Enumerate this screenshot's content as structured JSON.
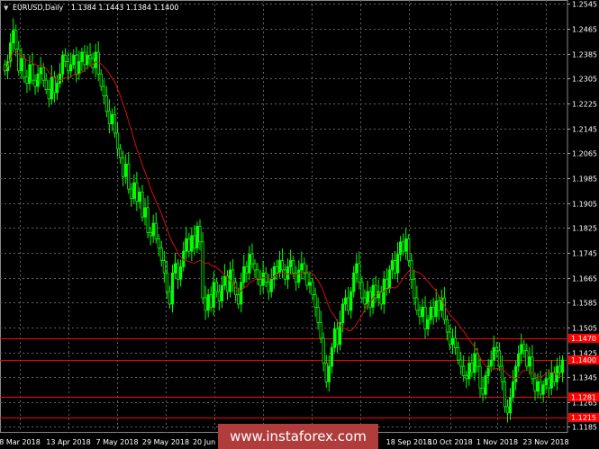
{
  "header": {
    "symbol": "EURUSD,Daily",
    "ohlc": "1.1384 1.1443 1.1384 1.1400"
  },
  "watermark": "www.instaforex.com",
  "colors": {
    "background": "#000000",
    "bull": "#00ff00",
    "bear": "#00ff00",
    "ma": "#d01010",
    "level": "#ff0000",
    "grid": "#606060",
    "price_box": "#ff0000"
  },
  "chart_data": {
    "type": "candlestick",
    "title": "EURUSD,Daily",
    "x_ticks": [
      "8 Mar 2018",
      "13 Apr 2018",
      "7 May 2018",
      "29 May 2018",
      "20 Jun 2018",
      "18 Sep 2018",
      "10 Oct 2018",
      "1 Nov 2018",
      "23 Nov 2018"
    ],
    "y_ticks": [
      "1.2545",
      "1.2465",
      "1.2385",
      "1.2305",
      "1.2225",
      "1.2145",
      "1.2065",
      "1.1985",
      "1.1905",
      "1.1825",
      "1.1745",
      "1.1665",
      "1.1585",
      "1.1505",
      "1.1425",
      "1.1345",
      "1.1265",
      "1.1185"
    ],
    "ylim": [
      1.1166,
      1.2558
    ],
    "grid": true,
    "levels": [
      {
        "value": 1.147,
        "label": "1.1470"
      },
      {
        "value": 1.14,
        "label": "1.1400"
      },
      {
        "value": 1.1281,
        "label": "1.1281"
      },
      {
        "value": 1.1215,
        "label": "1.1215"
      }
    ],
    "closes": [
      1.233,
      1.236,
      1.242,
      1.246,
      1.24,
      1.233,
      1.237,
      1.231,
      1.229,
      1.235,
      1.23,
      1.228,
      1.232,
      1.234,
      1.23,
      1.227,
      1.224,
      1.231,
      1.226,
      1.229,
      1.232,
      1.238,
      1.236,
      1.233,
      1.235,
      1.238,
      1.232,
      1.236,
      1.239,
      1.235,
      1.238,
      1.237,
      1.234,
      1.239,
      1.232,
      1.228,
      1.225,
      1.22,
      1.216,
      1.219,
      1.213,
      1.208,
      1.205,
      1.199,
      1.203,
      1.195,
      1.192,
      1.197,
      1.191,
      1.194,
      1.186,
      1.189,
      1.181,
      1.18,
      1.184,
      1.179,
      1.176,
      1.172,
      1.168,
      1.162,
      1.158,
      1.168,
      1.171,
      1.166,
      1.17,
      1.175,
      1.179,
      1.175,
      1.18,
      1.176,
      1.183,
      1.178,
      1.16,
      1.156,
      1.161,
      1.157,
      1.165,
      1.162,
      1.159,
      1.164,
      1.167,
      1.162,
      1.169,
      1.165,
      1.161,
      1.158,
      1.165,
      1.17,
      1.168,
      1.174,
      1.171,
      1.169,
      1.166,
      1.164,
      1.168,
      1.165,
      1.162,
      1.166,
      1.17,
      1.168,
      1.172,
      1.169,
      1.166,
      1.17,
      1.172,
      1.168,
      1.165,
      1.169,
      1.171,
      1.168,
      1.164,
      1.165,
      1.161,
      1.157,
      1.152,
      1.147,
      1.139,
      1.133,
      1.138,
      1.144,
      1.15,
      1.145,
      1.152,
      1.158,
      1.16,
      1.156,
      1.162,
      1.168,
      1.171,
      1.165,
      1.16,
      1.158,
      1.162,
      1.157,
      1.164,
      1.16,
      1.162,
      1.158,
      1.166,
      1.163,
      1.169,
      1.172,
      1.168,
      1.174,
      1.178,
      1.175,
      1.179,
      1.172,
      1.166,
      1.16,
      1.156,
      1.154,
      1.157,
      1.15,
      1.153,
      1.157,
      1.154,
      1.159,
      1.156,
      1.16,
      1.153,
      1.149,
      1.145,
      1.147,
      1.144,
      1.14,
      1.138,
      1.135,
      1.134,
      1.139,
      1.136,
      1.142,
      1.138,
      1.131,
      1.129,
      1.135,
      1.138,
      1.14,
      1.144,
      1.143,
      1.138,
      1.133,
      1.125,
      1.123,
      1.128,
      1.133,
      1.138,
      1.142,
      1.145,
      1.143,
      1.138,
      1.141,
      1.134,
      1.13,
      1.133,
      1.129,
      1.132,
      1.134,
      1.131,
      1.136,
      1.133,
      1.138,
      1.136,
      1.14
    ]
  }
}
